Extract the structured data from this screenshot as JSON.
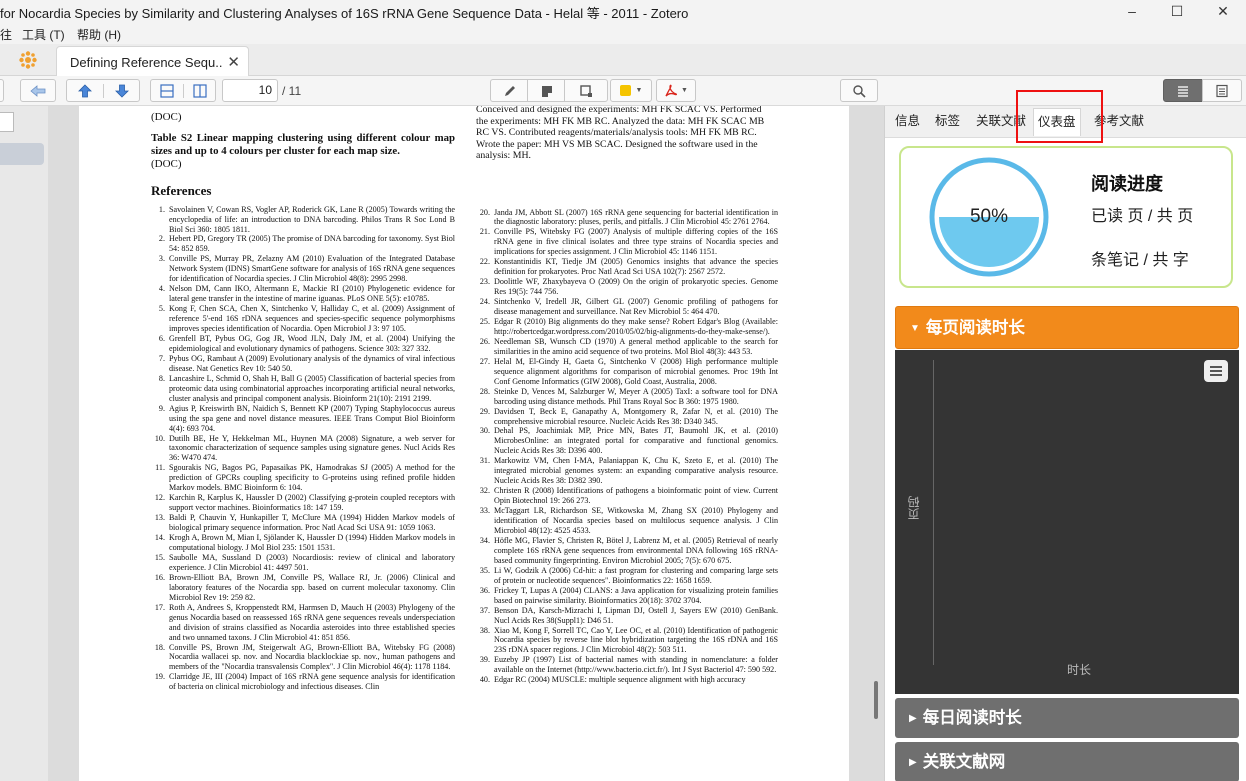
{
  "window": {
    "title": "for Nocardia Species by Similarity and Clustering Analyses of 16S rRNA Gene Sequence Data - Helal 等 - 2011 - Zotero",
    "minimize": "–",
    "maximize": "☐",
    "close": "✕"
  },
  "menu": {
    "items": [
      "往",
      "工具 (T)",
      "帮助 (H)"
    ]
  },
  "tabs": {
    "doc_tab_label": "Defining Reference Sequ...",
    "close_glyph": "✕"
  },
  "toolbar": {
    "page_current": "10",
    "page_total": "/ 11",
    "highlight_color": "#f5c400",
    "pdf_color": "#d9261c"
  },
  "pdf": {
    "top_left_lines": [
      "(DOC)"
    ],
    "table_title": "Table S2 Linear mapping clustering using different colour map sizes and up to 4 colours per cluster for each map size.",
    "table_after": "(DOC)",
    "references_heading": "References",
    "top_right_lines": [
      "Conceived and designed the experiments: MH FK SCAC VS. Performed",
      "the experiments: MH FK MB RC. Analyzed the data: MH FK SCAC MB",
      "RC VS. Contributed reagents/materials/analysis tools: MH FK MB RC.",
      "Wrote the paper: MH VS MB SCAC. Designed the software used in the",
      "analysis: MH."
    ],
    "refs_left": [
      {
        "n": "1.",
        "t": "Savolainen V, Cowan RS, Vogler AP, Roderick GK, Lane R (2005) Towards writing the encyclopedia of life: an introduction to DNA barcoding. Philos Trans R Soc Lond B Biol Sci 360: 1805 1811."
      },
      {
        "n": "2.",
        "t": "Hebert PD, Gregory TR (2005) The promise of DNA barcoding for taxonomy. Syst Biol 54: 852 859."
      },
      {
        "n": "3.",
        "t": "Conville PS, Murray PR, Zelazny AM (2010) Evaluation of the Integrated Database Network System (IDNS) SmartGene software for analysis of 16S rRNA gene sequences for identification of Nocardia species. J Clin Microbiol 48(8): 2995 2998."
      },
      {
        "n": "4.",
        "t": "Nelson DM, Cann IKO, Altermann E, Mackie RI (2010) Phylogenetic evidence for lateral gene transfer in the intestine of marine iguanas. PLoS ONE 5(5): e10785."
      },
      {
        "n": "5.",
        "t": "Kong F, Chen SCA, Chen X, Sintchenko V, Halliday C, et al. (2009) Assignment of reference 5'-end 16S rDNA sequences and species-specific sequence polymorphisms improves species identification of Nocardia. Open Microbiol J 3: 97 105."
      },
      {
        "n": "6.",
        "t": "Grenfell BT, Pybus OG, Gog JR, Wood JLN, Daly JM, et al. (2004) Unifying the epidemiological and evolutionary dynamics of pathogens. Science 303: 327 332."
      },
      {
        "n": "7.",
        "t": "Pybus OG, Rambaut A (2009) Evolutionary analysis of the dynamics of viral infectious disease. Nat Genetics Rev 10: 540 50."
      },
      {
        "n": "8.",
        "t": "Lancashire L, Schmid O, Shah H, Ball G (2005) Classification of bacterial species from proteomic data using combinatorial approaches incorporating artificial neural networks, cluster analysis and principal component analysis. Bioinform 21(10): 2191 2199."
      },
      {
        "n": "9.",
        "t": "Agius P, Kreiswirth BN, Naidich S, Bennett KP (2007) Typing Staphylococcus aureus using the spa gene and novel distance measures. IEEE Trans Comput Biol Bioinform 4(4): 693 704."
      },
      {
        "n": "10.",
        "t": "Dutilh BE, He Y, Hekkelman ML, Huynen MA (2008) Signature, a web server for taxonomic characterization of sequence samples using signature genes. Nucl Acids Res 36: W470 474."
      },
      {
        "n": "11.",
        "t": "Sgourakis NG, Bagos PG, Papasaikas PK, Hamodrakas SJ (2005) A method for the prediction of GPCRs coupling specificity to G-proteins using refined profile hidden Markov models. BMC Bioinform 6: 104."
      },
      {
        "n": "12.",
        "t": "Karchin R, Karplus K, Haussler D (2002) Classifying g-protein coupled receptors with support vector machines. Bioinformatics 18: 147 159."
      },
      {
        "n": "13.",
        "t": "Baldi P, Chauvin Y, Hunkapiller T, McClure MA (1994) Hidden Markov models of biological primary sequence information. Proc Natl Acad Sci USA 91: 1059 1063."
      },
      {
        "n": "14.",
        "t": "Krogh A, Brown M, Mian I, Sjölander K, Haussler D (1994) Hidden Markov models in computational biology. J Mol Biol 235: 1501 1531."
      },
      {
        "n": "15.",
        "t": "Saubolle MA, Sussland D (2003) Nocardiosis: review of clinical and laboratory experience. J Clin Microbiol 41: 4497 501."
      },
      {
        "n": "16.",
        "t": "Brown-Elliott BA, Brown JM, Conville PS, Wallace RJ, Jr. (2006) Clinical and laboratory features of the Nocardia spp. based on current molecular taxonomy. Clin Microbiol Rev 19: 259 82."
      },
      {
        "n": "17.",
        "t": "Roth A, Andrees S, Kroppenstedt RM, Harmsen D, Mauch H (2003) Phylogeny of the genus Nocardia based on reassessed 16S rRNA gene sequences reveals underspeciation and division of strains classified as Nocardia asteroides into three established species and two unnamed taxons. J Clin Microbiol 41: 851 856."
      },
      {
        "n": "18.",
        "t": "Conville PS, Brown JM, Steigerwalt AG, Brown-Elliott BA, Witebsky FG (2008) Nocardia wallacei sp. nov. and Nocardia blacklockiae sp. nov., human pathogens and members of the \"Nocardia transvalensis Complex\". J Clin Microbiol 46(4): 1178 1184."
      },
      {
        "n": "19.",
        "t": "Clarridge JE, III (2004) Impact of 16S rRNA gene sequence analysis for identification of bacteria on clinical microbiology and infectious diseases. Clin"
      }
    ],
    "refs_right": [
      {
        "n": "20.",
        "t": "Janda JM, Abbott SL (2007) 16S rRNA gene sequencing for bacterial identification in the diagnostic laboratory: pluses, perils, and pitfalls. J Clin Microbiol 45: 2761 2764."
      },
      {
        "n": "21.",
        "t": "Conville PS, Witebsky FG (2007) Analysis of multiple differing copies of the 16S rRNA gene in five clinical isolates and three type strains of Nocardia species and implications for species assignment. J Clin Microbiol 45: 1146 1151."
      },
      {
        "n": "22.",
        "t": "Konstantinidis KT, Tiedje JM (2005) Genomics insights that advance the species definition for prokaryotes. Proc Natl Acad Sci USA 102(7): 2567 2572."
      },
      {
        "n": "23.",
        "t": "Doolittle WF, Zhaxybayeva O (2009) On the origin of prokaryotic species. Genome Res 19(5): 744 756."
      },
      {
        "n": "24.",
        "t": "Sintchenko V, Iredell JR, Gilbert GL (2007) Genomic profiling of pathogens for disease management and surveillance. Nat Rev Microbiol 5: 464 470."
      },
      {
        "n": "25.",
        "t": "Edgar R (2010) Big alignments do they make sense? Robert Edgar's Blog (Available: http://robertcedgar.wordpress.com/2010/05/02/big-alignments-do-they-make-sense/)."
      },
      {
        "n": "26.",
        "t": "Needleman SB, Wunsch CD (1970) A general method applicable to the search for similarities in the amino acid sequence of two proteins. Mol Biol 48(3): 443 53."
      },
      {
        "n": "27.",
        "t": "Helal M, El-Gindy H, Gaeta G, Sintchenko V (2008) High performance multiple sequence alignment algorithms for comparison of microbial genomes. Proc 19th Int Conf Genome Informatics (GIW 2008), Gold Coast, Australia, 2008."
      },
      {
        "n": "28.",
        "t": "Steinke D, Vences M, Salzburger W, Meyer A (2005) TaxI: a software tool for DNA barcoding using distance methods. Phil Trans Royal Soc B 360: 1975 1980."
      },
      {
        "n": "29.",
        "t": "Davidsen T, Beck E, Ganapathy A, Montgomery R, Zafar N, et al. (2010) The comprehensive microbial resource. Nucleic Acids Res 38: D340 345."
      },
      {
        "n": "30.",
        "t": "Dehal PS, Joachimiak MP, Price MN, Bates JT, Baumohl JK, et al. (2010) MicrobesOnline: an integrated portal for comparative and functional genomics. Nucleic Acids Res 38: D396 400."
      },
      {
        "n": "31.",
        "t": "Markowitz VM, Chen I-MA, Palaniappan K, Chu K, Szeto E, et al. (2010) The integrated microbial genomes system: an expanding comparative analysis resource. Nucleic Acids Res 38: D382 390."
      },
      {
        "n": "32.",
        "t": "Christen R (2008) Identifications of pathogens a bioinformatic point of view. Current Opin Biotechnol 19: 266 273."
      },
      {
        "n": "33.",
        "t": "McTaggart LR, Richardson SE, Witkowska M, Zhang SX (2010) Phylogeny and identification of Nocardia species based on multilocus sequence analysis. J Clin Microbiol 48(12): 4525 4533."
      },
      {
        "n": "34.",
        "t": "Höfle MG, Flavier S, Christen R, Bötel J, Labrenz M, et al. (2005) Retrieval of nearly complete 16S rRNA gene sequences from environmental DNA following 16S rRNA-based community fingerprinting. Environ Microbiol 2005; 7(5): 670 675."
      },
      {
        "n": "35.",
        "t": "Li W, Godzik A (2006) Cd-hit: a fast program for clustering and comparing large sets of protein or nucleotide sequences\". Bioinformatics 22: 1658 1659."
      },
      {
        "n": "36.",
        "t": "Frickey T, Lupas A (2004) CLANS: a Java application for visualizing protein families based on pairwise similarity. Bioinformatics 20(18): 3702 3704."
      },
      {
        "n": "37.",
        "t": "Benson DA, Karsch-Mizrachi I, Lipman DJ, Ostell J, Sayers EW (2010) GenBank. Nucl Acids Res 38(Suppl1): D46 51."
      },
      {
        "n": "38.",
        "t": "Xiao M, Kong F, Sorrell TC, Cao Y, Lee OC, et al. (2010) Identification of pathogenic Nocardia species by reverse line blot hybridization targeting the 16S rDNA and 16S 23S rDNA spacer regions. J Clin Microbiol 48(2): 503 511."
      },
      {
        "n": "39.",
        "t": "Euzeby JP (1997) List of bacterial names with standing in nomenclature: a folder available on the Internet (http://www.bacterio.cict.fr/). Int J Syst Bacteriol 47: 590 592."
      },
      {
        "n": "40.",
        "t": "Edgar RC (2004) MUSCLE: multiple sequence alignment with high accuracy"
      }
    ]
  },
  "sidepanel": {
    "tabs": [
      "信息",
      "标签",
      "关联文献",
      "仪表盘",
      "参考文献"
    ],
    "active_tab_index": 3,
    "progress": {
      "title": "阅读进度",
      "percent_text": "50%",
      "percent_value": 0.5,
      "pages_text": "已读 页 / 共 页",
      "notes_text": "条笔记 / 共 字"
    },
    "section_page_time": "每页阅读时长",
    "section_daily_time": "每日阅读时长",
    "section_related": "关联文献网",
    "chart": {
      "y_label": "页码",
      "x_label": "时长"
    },
    "colors": {
      "accent_orange": "#f28a1b",
      "progress_fill": "#6ec9ef",
      "card_border": "#c8e68c",
      "highlight_box": "#e11111"
    }
  }
}
